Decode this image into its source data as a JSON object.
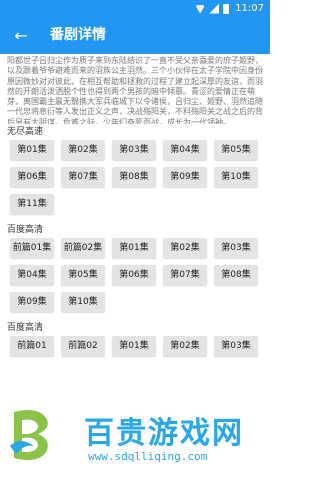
{
  "status_bar": {
    "time": "11:07",
    "icons": [
      "wifi-icon",
      "signal-icon",
      "battery-icon"
    ]
  },
  "toolbar": {
    "back_icon": "←",
    "title": "番剧详情"
  },
  "description": "阳都世子吕归尘作为质子来到东陆结识了一直不受父亲喜爱的庶子姬野，以及跟着爷爷避难而来的羽族公主羽然。三个小伙伴在太子学院中因身份原因微妙对对彼此，在相互帮助和拯救的过程了建立起深厚的友谊，而羽然的开朗活泼洒脱个性也得到两个男孩的暗中倾慕。青涩的爱情正在萌芽，离国霸主嬴无翳携大军兵临城下以令诸侯，吕归尘、姬野、羽然追随一代忠将息衍等人发出正义之声，决战殇阳关，不料殇阳关之战之后的背后另有大阴谋，危难之际，少年们奋死而战，成长为一代领袖。",
  "sections": [
    {
      "title": "无尽高速",
      "episodes": [
        "第01集",
        "第02集",
        "第03集",
        "第04集",
        "第05集",
        "第06集",
        "第07集",
        "第08集",
        "第09集",
        "第10集",
        "第11集"
      ]
    },
    {
      "title": "百度高清",
      "episodes": [
        "前篇01集",
        "前篇02集",
        "第01集",
        "第02集",
        "第03集",
        "第04集",
        "第05集",
        "第06集",
        "第07集",
        "第08集",
        "第09集",
        "第10集"
      ]
    },
    {
      "title": "百度高清",
      "episodes": [
        "前篇01",
        "前篇02",
        "第01集",
        "第02集",
        "第03集"
      ]
    }
  ],
  "watermark": {
    "title": "百贵游戏网",
    "url": "www.sdqlliqing.com",
    "color": "#2aa7e8"
  },
  "colors": {
    "primary": "#2196f3",
    "button_bg": "#e4e4e4"
  }
}
